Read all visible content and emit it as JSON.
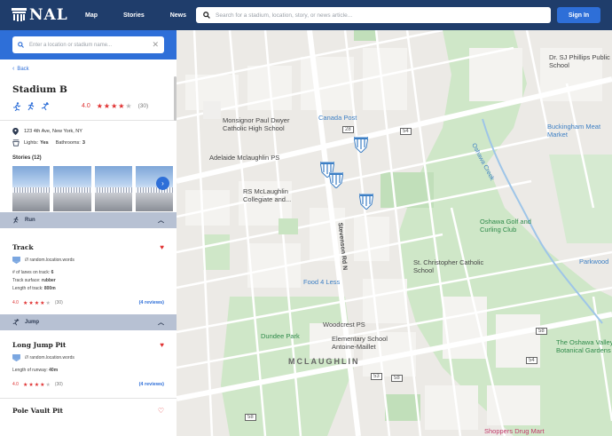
{
  "header": {
    "logo_text": "NAL",
    "nav": [
      "Map",
      "Stories",
      "News"
    ],
    "search_placeholder": "Search for a stadium, location, story, or news article...",
    "signin_label": "Sign In"
  },
  "panel": {
    "search_placeholder": "Enter a location or stadium name...",
    "back_label": "Back",
    "stadium_name": "Stadium B",
    "rating": "4.0",
    "rating_count": "(30)",
    "stars_filled": 4,
    "address": "123 4th Ave, New York, NY",
    "lights_label": "Lights:",
    "lights_value": "Yes",
    "bathrooms_label": "Bathrooms:",
    "bathrooms_value": "3",
    "stories_label": "Stories (12)",
    "sections": [
      {
        "title": "Run",
        "facilities": [
          {
            "name": "Track",
            "location": "/// random.location.words",
            "details": [
              {
                "label": "# of lanes on track:",
                "value": "6"
              },
              {
                "label": "Track surface:",
                "value": "rubber"
              },
              {
                "label": "Length of track:",
                "value": "800m"
              }
            ],
            "rating": "4.0",
            "rating_count": "(30)",
            "reviews": "(4 reviews)",
            "favorited": true
          }
        ]
      },
      {
        "title": "Jump",
        "facilities": [
          {
            "name": "Long Jump Pit",
            "location": "/// random.location.words",
            "details": [
              {
                "label": "Length of runway:",
                "value": "40m"
              }
            ],
            "rating": "4.0",
            "rating_count": "(30)",
            "reviews": "(4 reviews)",
            "favorited": true
          },
          {
            "name": "Pole Vault Pit",
            "favorited": false
          }
        ]
      }
    ]
  },
  "map": {
    "places": [
      "Dr. SJ Phillips Public School",
      "Monsignor Paul Dwyer Catholic High School",
      "Canada Post",
      "Buckingham Meat Market",
      "Adelaide Mclaughlin PS",
      "RS McLaughlin Collegiate and...",
      "Oshawa Golf and Curling Club",
      "St. Christopher Catholic School",
      "Food 4 Less",
      "Woodcrest PS",
      "Dundee Park",
      "Elementary School Antoine-Maillet",
      "The Oshawa Valley Botanical Gardens",
      "Shoppers Drug Mart",
      "Parkwood",
      "MCLAUGHLIN",
      "Oshawa Creek",
      "Stevenson Rd N"
    ],
    "route_numbers": [
      "54",
      "28",
      "58",
      "53",
      "58",
      "54",
      "58"
    ]
  },
  "colors": {
    "header_bg": "#1f3d6b",
    "accent": "#2e6fd8",
    "star_filled": "#e03030",
    "section_bar": "#b7c1d3"
  }
}
